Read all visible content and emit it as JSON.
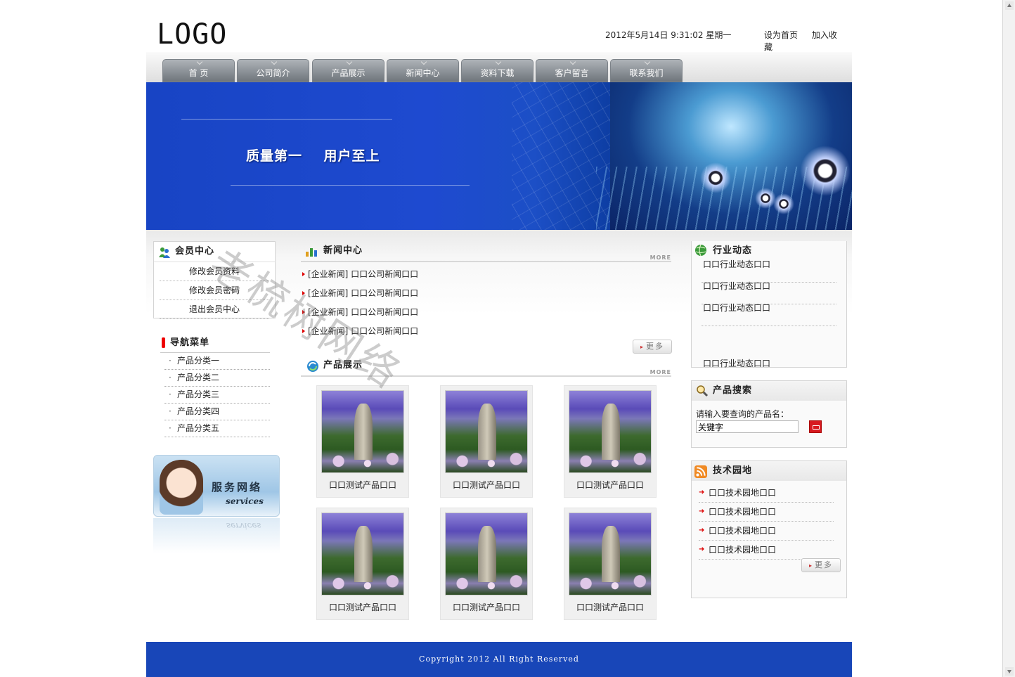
{
  "header": {
    "logo": "LOGO",
    "datetime": "2012年5月14日 9:31:02 星期一",
    "set_home": "设为首页",
    "add_favorite": "加入收藏"
  },
  "nav": [
    "首 页",
    "公司简介",
    "产品展示",
    "新闻中心",
    "资料下载",
    "客户留言",
    "联系我们"
  ],
  "banner": {
    "slogan": "质量第一    用户至上"
  },
  "member": {
    "title": "会员中心",
    "items": [
      "修改会员资料",
      "修改会员密码",
      "退出会员中心"
    ]
  },
  "nav_menu": {
    "title": "导航菜单",
    "items": [
      "产品分类一",
      "产品分类二",
      "产品分类三",
      "产品分类四",
      "产品分类五"
    ]
  },
  "service": {
    "title": "服务网络",
    "subtitle": "services"
  },
  "news": {
    "title": "新闻中心",
    "more": "MORE",
    "more_button": "更多",
    "items": [
      "[企业新闻] 口口公司新闻口口",
      "[企业新闻] 口口公司新闻口口",
      "[企业新闻] 口口公司新闻口口",
      "[企业新闻] 口口公司新闻口口"
    ]
  },
  "products": {
    "title": "产品展示",
    "more": "MORE",
    "items": [
      "口口测试产品口口",
      "口口测试产品口口",
      "口口测试产品口口",
      "口口测试产品口口",
      "口口测试产品口口",
      "口口测试产品口口"
    ]
  },
  "industry": {
    "title": "行业动态",
    "items": [
      "口口行业动态口口",
      "口口行业动态口口",
      "口口行业动态口口",
      "口口行业动态口口"
    ]
  },
  "search": {
    "title": "产品搜索",
    "label": "请输入要查询的产品名：",
    "value": "关键字"
  },
  "tech": {
    "title": "技术园地",
    "more_button": "更多",
    "items": [
      "口口技术园地口口",
      "口口技术园地口口",
      "口口技术园地口口",
      "口口技术园地口口"
    ]
  },
  "footer": {
    "copyright": "Copyright 2012 All Right Reserved"
  },
  "watermark": "老梳树网络",
  "colors": {
    "brand_blue": "#1846b8",
    "accent_red": "#d71920"
  }
}
